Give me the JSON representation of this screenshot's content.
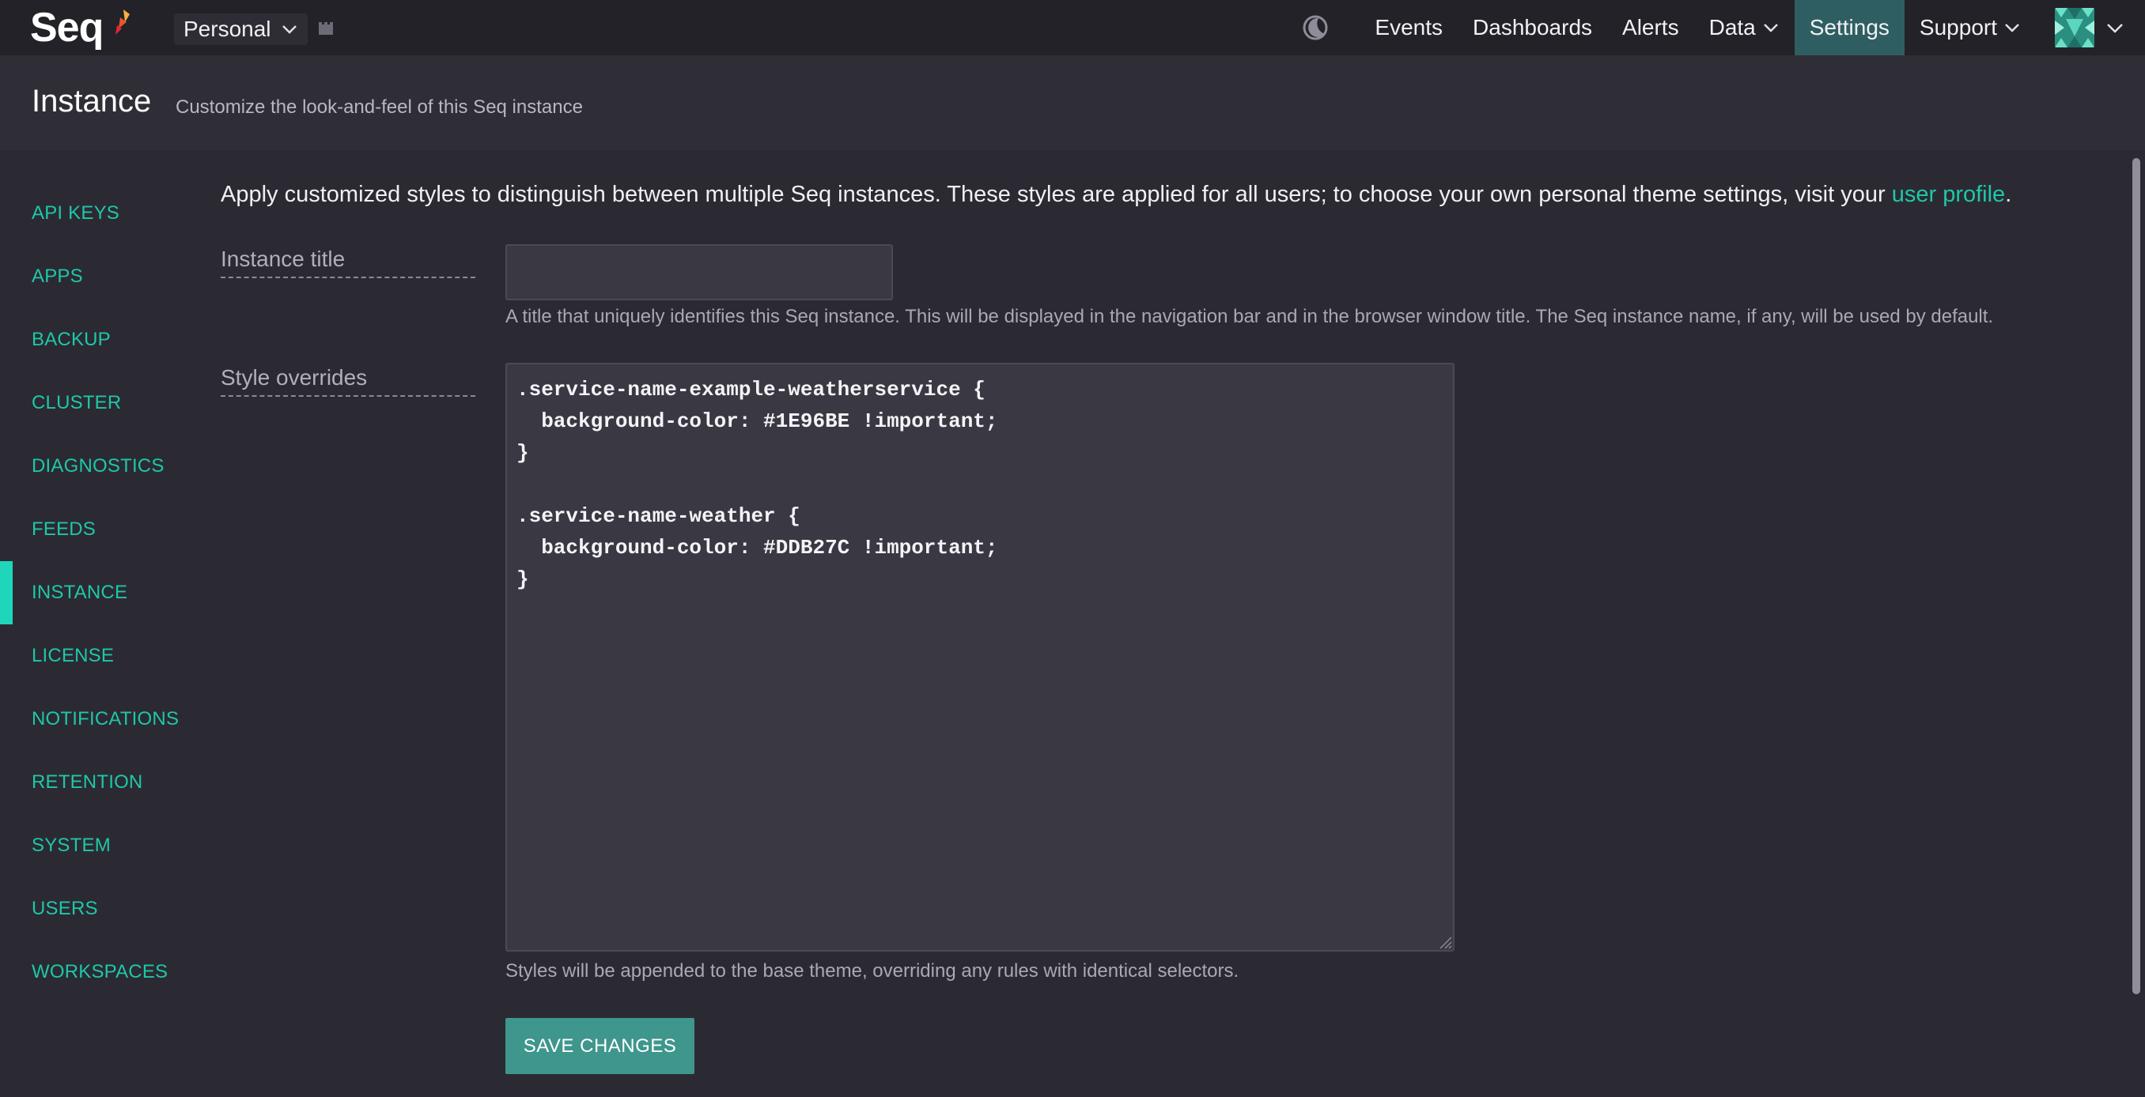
{
  "app": {
    "logo_text": "Seq",
    "workspace": "Personal"
  },
  "nav": {
    "items": [
      {
        "label": "Events"
      },
      {
        "label": "Dashboards"
      },
      {
        "label": "Alerts"
      },
      {
        "label": "Data"
      },
      {
        "label": "Settings"
      },
      {
        "label": "Support"
      }
    ],
    "active": "Settings"
  },
  "header": {
    "title": "Instance",
    "subtitle": "Customize the look-and-feel of this Seq instance"
  },
  "sidebar": {
    "items": [
      {
        "label": "API KEYS"
      },
      {
        "label": "APPS"
      },
      {
        "label": "BACKUP"
      },
      {
        "label": "CLUSTER"
      },
      {
        "label": "DIAGNOSTICS"
      },
      {
        "label": "FEEDS"
      },
      {
        "label": "INSTANCE"
      },
      {
        "label": "LICENSE"
      },
      {
        "label": "NOTIFICATIONS"
      },
      {
        "label": "RETENTION"
      },
      {
        "label": "SYSTEM"
      },
      {
        "label": "USERS"
      },
      {
        "label": "WORKSPACES"
      }
    ],
    "active": "INSTANCE"
  },
  "content": {
    "intro_text": "Apply customized styles to distinguish between multiple Seq instances. These styles are applied for all users; to choose your own personal theme settings, visit your ",
    "intro_link": "user profile",
    "intro_end": ".",
    "instance_title_label": "Instance title",
    "instance_title_value": "",
    "instance_title_help": "A title that uniquely identifies this Seq instance. This will be displayed in the navigation bar and in the browser window title. The Seq instance name, if any, will be used by default.",
    "style_overrides_label": "Style overrides",
    "style_overrides_value": ".service-name-example-weatherservice {\n  background-color: #1E96BE !important;\n}\n\n.service-name-weather {\n  background-color: #DDB27C !important;\n}",
    "style_overrides_help": "Styles will be appended to the base theme, overriding any rules with identical selectors.",
    "save_label": "SAVE CHANGES"
  },
  "colors": {
    "accent": "#1fc7a8",
    "active_nav": "#2f5e62",
    "save_button": "#3e968c"
  },
  "icons": {
    "logo_mark": "seq-flame-icon",
    "workspace": "workspace-castle-icon",
    "theme": "moon-icon",
    "avatar": "identicon-avatar"
  }
}
